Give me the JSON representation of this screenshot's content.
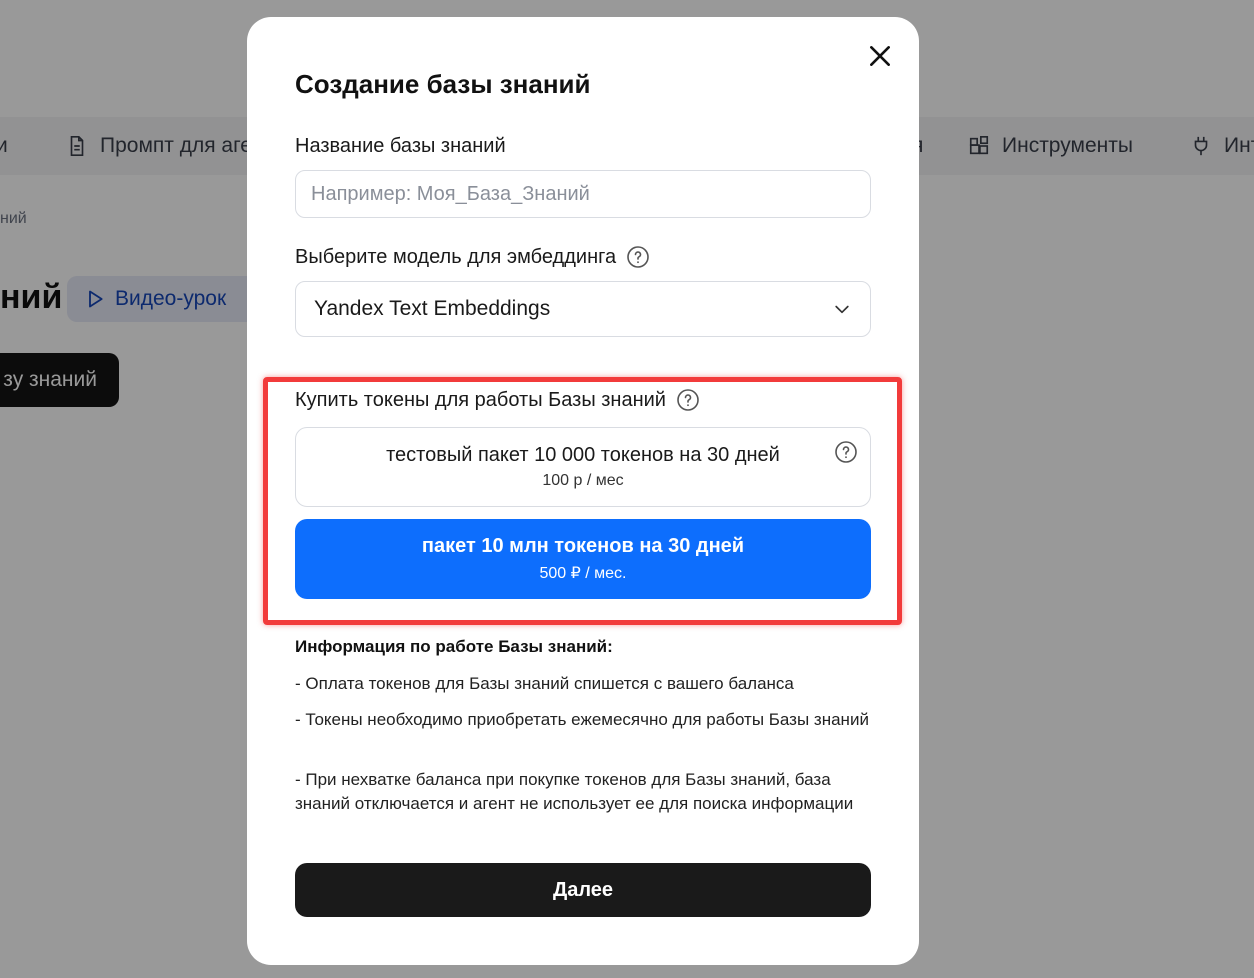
{
  "background": {
    "tabs": [
      {
        "label": "и",
        "icon": "none"
      },
      {
        "label": "Промпт для агента",
        "icon": "document-icon"
      },
      {
        "label": "я",
        "icon": "none"
      },
      {
        "label": "Инструменты",
        "icon": "widgets-icon"
      },
      {
        "label": "Инт",
        "icon": "plug-icon"
      }
    ],
    "breadcrumb": "ний",
    "page_title": "ний",
    "video_button": "Видео-урок",
    "create_button": "зу знаний"
  },
  "modal": {
    "title": "Создание базы знаний",
    "name_label": "Название базы знаний",
    "name_placeholder": "Например: Моя_База_Знаний",
    "name_value": "",
    "model_label": "Выберите модель для эмбеддинга",
    "model_selected": "Yandex Text Embeddings",
    "tokens_label": "Купить токены для работы Базы знаний",
    "packages": [
      {
        "name": "тестовый пакет 10 000 токенов на 30 дней",
        "price": "100 р / мес"
      },
      {
        "name": "пакет 10 млн токенов на 30 дней",
        "price": "500 ₽ / мес."
      }
    ],
    "info_title": "Информация по работе Базы знаний:",
    "info_items": [
      "- Оплата токенов для Базы знаний спишется с вашего баланса",
      "- Токены необходимо приобретать ежемесячно для работы Базы знаний",
      "- При нехватке баланса при покупке токенов для Базы знаний, база знаний отключается и агент не использует ее для поиска информации"
    ],
    "next_button": "Далее"
  },
  "colors": {
    "accent": "#0d6efd",
    "highlight": "#f23b3b",
    "dark_button": "#1a1a1a"
  }
}
